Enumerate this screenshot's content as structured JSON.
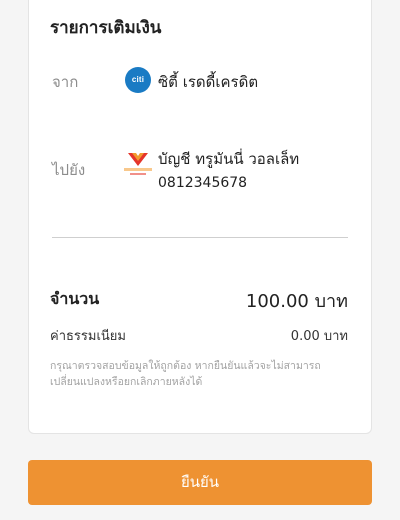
{
  "header": {
    "title": "รายการเติมเงิน"
  },
  "source": {
    "label": "จาก",
    "logo_text": "citi",
    "logo_icon": "citi-bank-logo",
    "name": "ซิตี้ เรดดี้เครดิต"
  },
  "destination": {
    "label": "ไปยัง",
    "logo_icon": "truemoney-wallet-logo",
    "logo_text": "true money wallet",
    "account_name": "บัญชี ทรูมันนี่ วอลเล็ท",
    "account_number": "0812345678"
  },
  "summary": {
    "amount_label": "จำนวน",
    "amount_value": "100.00 บาท",
    "fee_label": "ค่าธรรมเนียม",
    "fee_value": "0.00 บาท"
  },
  "note": "กรุณาตรวจสอบข้อมูลให้ถูกต้อง หากยืนยันแล้วจะไม่สามารถเปลี่ยนแปลงหรือยกเลิกภายหลังได้",
  "actions": {
    "confirm_label": "ยืนยัน"
  },
  "colors": {
    "accent": "#ee9232",
    "citi_blue": "#1a7bc4",
    "truemoney_red": "#e5342a",
    "truemoney_orange": "#f29a2e"
  }
}
